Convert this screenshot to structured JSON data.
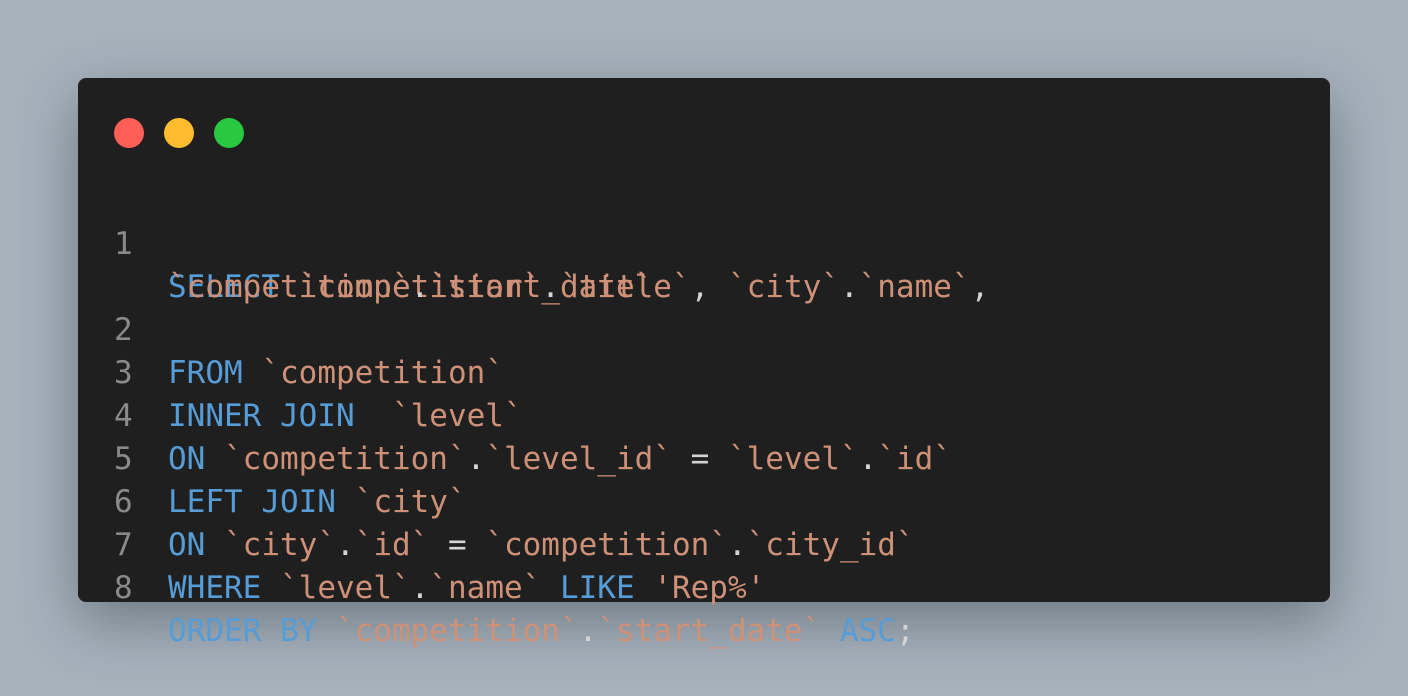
{
  "window": {
    "buttons": {
      "close_color": "#ff5f57",
      "minimize_color": "#febc2e",
      "maximize_color": "#28c840"
    }
  },
  "theme": {
    "background": "#1f1f1f",
    "keyword_color": "#569cd6",
    "identifier_color": "#ce9178",
    "line_number_color": "#8a8a8a"
  },
  "code": {
    "line1_no": "1",
    "line1": {
      "t0": "SELECT",
      "t1": " ",
      "t2": "`competition`",
      "t3": ".",
      "t4": "`title`",
      "t5": ", ",
      "t6": "`city`",
      "t7": ".",
      "t8": "`name`",
      "t9": ","
    },
    "line1_wrap": {
      "t0": "`competition`",
      "t1": ".",
      "t2": "`start_date`"
    },
    "line2_no": "2",
    "line2": {
      "t0": "FROM",
      "t1": " ",
      "t2": "`competition`"
    },
    "line3_no": "3",
    "line3": {
      "t0": "INNER JOIN",
      "t1": "  ",
      "t2": "`level`"
    },
    "line4_no": "4",
    "line4": {
      "t0": "ON",
      "t1": " ",
      "t2": "`competition`",
      "t3": ".",
      "t4": "`level_id`",
      "t5": " = ",
      "t6": "`level`",
      "t7": ".",
      "t8": "`id`"
    },
    "line5_no": "5",
    "line5": {
      "t0": "LEFT JOIN",
      "t1": " ",
      "t2": "`city`"
    },
    "line6_no": "6",
    "line6": {
      "t0": "ON",
      "t1": " ",
      "t2": "`city`",
      "t3": ".",
      "t4": "`id`",
      "t5": " = ",
      "t6": "`competition`",
      "t7": ".",
      "t8": "`city_id`"
    },
    "line7_no": "7",
    "line7": {
      "t0": "WHERE",
      "t1": " ",
      "t2": "`level`",
      "t3": ".",
      "t4": "`name`",
      "t5": " ",
      "t6": "LIKE",
      "t7": " ",
      "t8": "'Rep%'"
    },
    "line8_no": "8",
    "line8": {
      "t0": "ORDER BY",
      "t1": " ",
      "t2": "`competition`",
      "t3": ".",
      "t4": "`start_date`",
      "t5": " ",
      "t6": "ASC",
      "t7": ";"
    }
  }
}
